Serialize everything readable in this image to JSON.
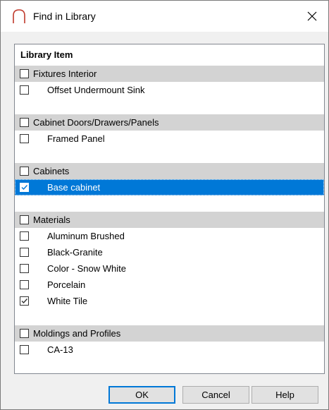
{
  "window": {
    "title": "Find in Library",
    "icon": "arch-icon",
    "close_icon": "close-icon"
  },
  "list": {
    "header": "Library Item",
    "groups": [
      {
        "label": "Fixtures Interior",
        "checked": false,
        "items": [
          {
            "label": "Offset Undermount Sink",
            "checked": false,
            "selected": false
          }
        ]
      },
      {
        "label": "Cabinet Doors/Drawers/Panels",
        "checked": false,
        "items": [
          {
            "label": "Framed Panel",
            "checked": false,
            "selected": false
          }
        ]
      },
      {
        "label": "Cabinets",
        "checked": false,
        "items": [
          {
            "label": "Base cabinet",
            "checked": true,
            "selected": true
          }
        ]
      },
      {
        "label": "Materials",
        "checked": false,
        "items": [
          {
            "label": "Aluminum Brushed",
            "checked": false,
            "selected": false
          },
          {
            "label": "Black-Granite",
            "checked": false,
            "selected": false
          },
          {
            "label": "Color - Snow White",
            "checked": false,
            "selected": false
          },
          {
            "label": "Porcelain",
            "checked": false,
            "selected": false
          },
          {
            "label": "White Tile",
            "checked": true,
            "selected": false
          }
        ]
      },
      {
        "label": "Moldings and Profiles",
        "checked": false,
        "items": [
          {
            "label": "CA-13",
            "checked": false,
            "selected": false
          }
        ]
      }
    ]
  },
  "buttons": {
    "ok": "OK",
    "cancel": "Cancel",
    "help": "Help"
  },
  "colors": {
    "selection": "#0078d7",
    "group_background": "#d3d3d3",
    "icon_red": "#c0392b"
  }
}
